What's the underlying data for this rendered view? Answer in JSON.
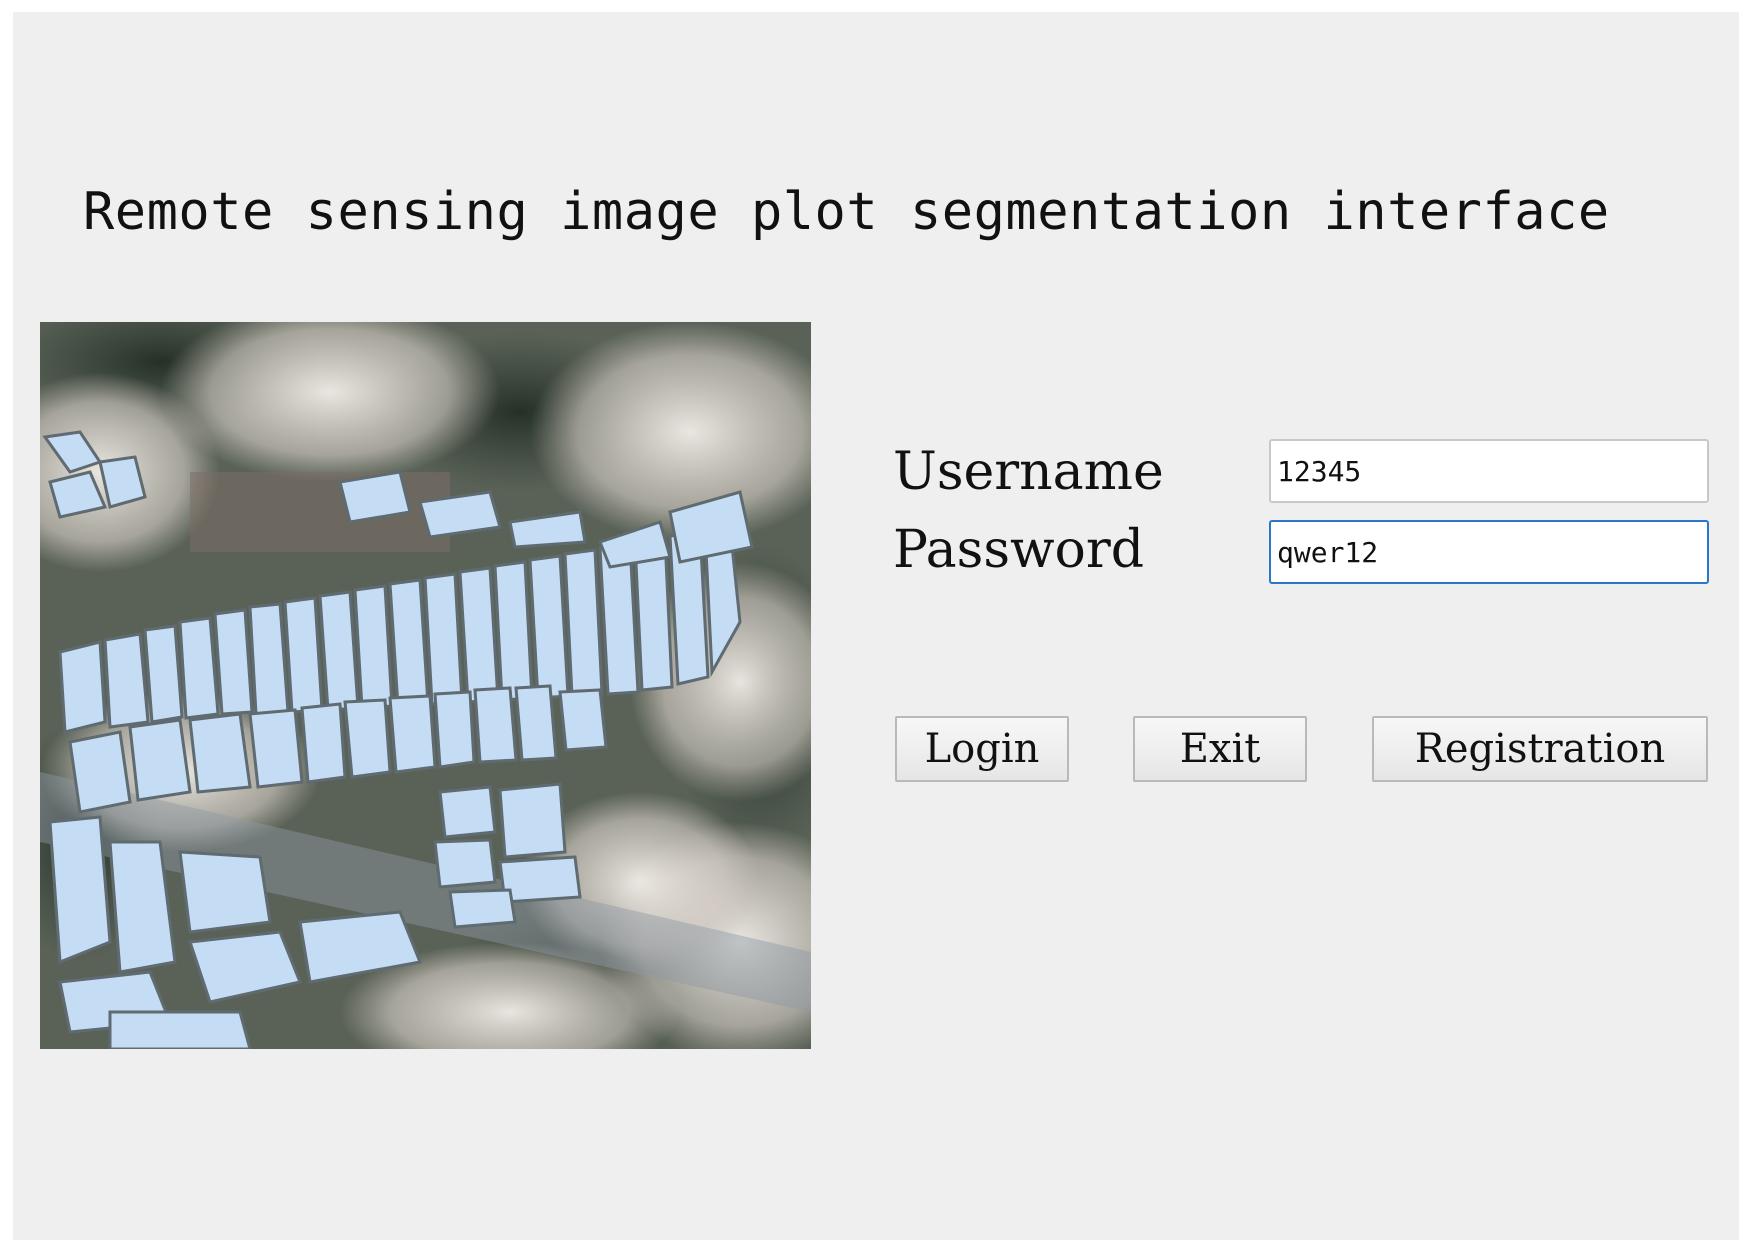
{
  "window": {
    "title": "Remote sensing image plot segmentation interface"
  },
  "login_form": {
    "username_label": "Username",
    "username_value": "12345",
    "password_label": "Password",
    "password_value": "qwer12"
  },
  "buttons": {
    "login_label": "Login",
    "exit_label": "Exit",
    "registration_label": "Registration"
  },
  "image": {
    "description_name": "segmented-satellite-image",
    "plot_fill_color": "#c4ddf4",
    "plot_edge_color": "#5f6b70"
  }
}
